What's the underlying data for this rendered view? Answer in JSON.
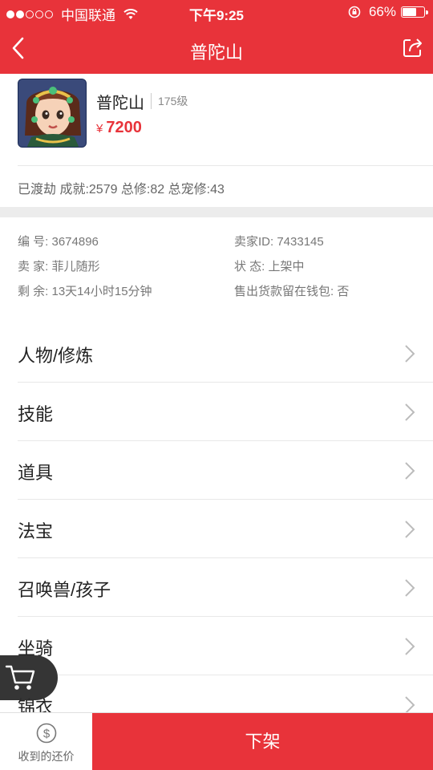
{
  "status_bar": {
    "carrier": "中国联通",
    "time": "下午9:25",
    "battery": "66%",
    "battery_level": 0.66
  },
  "nav": {
    "title": "普陀山"
  },
  "character": {
    "name": "普陀山",
    "level": "175级",
    "price_symbol": "¥",
    "price": "7200",
    "stats": "已渡劫 成就:2579 总修:82 总宠修:43"
  },
  "info": {
    "id": "编  号: 3674896",
    "seller_id": "卖家ID: 7433145",
    "seller": "卖  家: 菲儿随形",
    "status": "状  态: 上架中",
    "remaining": "剩  余: 13天14小时15分钟",
    "wallet": "售出货款留在钱包: 否"
  },
  "menu": {
    "items": [
      {
        "label": "人物/修炼"
      },
      {
        "label": "技能"
      },
      {
        "label": "道具"
      },
      {
        "label": "法宝"
      },
      {
        "label": "召唤兽/孩子"
      },
      {
        "label": "坐骑"
      },
      {
        "label": "锦衣"
      }
    ]
  },
  "bottom": {
    "offer_label": "收到的还价",
    "delist_label": "下架"
  },
  "colors": {
    "accent": "#e8333a"
  }
}
